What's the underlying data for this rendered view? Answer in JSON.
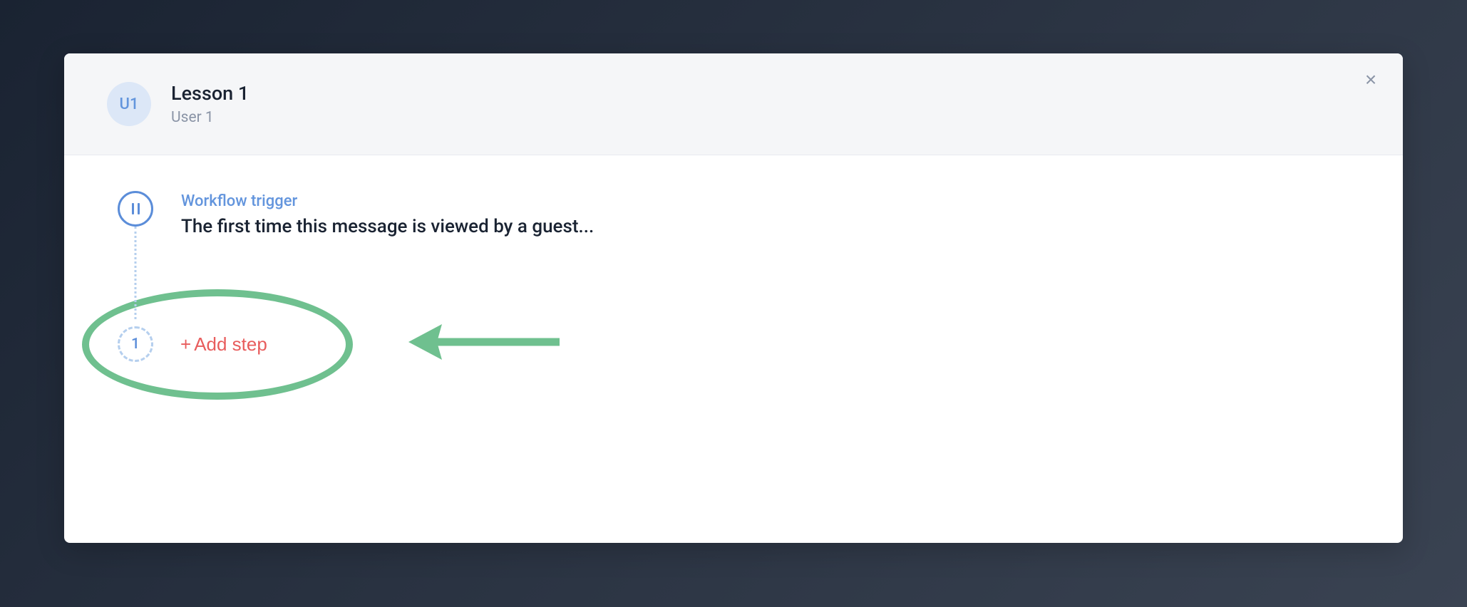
{
  "header": {
    "avatar_initials": "U1",
    "title": "Lesson 1",
    "subtitle": "User 1"
  },
  "workflow": {
    "trigger": {
      "label": "Workflow trigger",
      "description": "The first time this message is viewed by a guest..."
    },
    "next_step_number": "1",
    "add_step_label": "Add step"
  },
  "colors": {
    "accent_blue": "#5b8dd9",
    "action_red": "#e85d5d",
    "highlight_green": "#6fc08f"
  }
}
